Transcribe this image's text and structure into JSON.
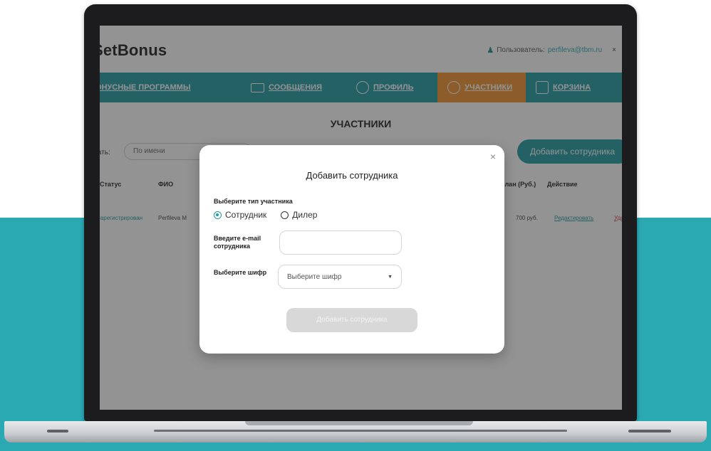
{
  "app": {
    "brand": "SetBonus",
    "user_label": "Пользователь:",
    "user_email": "perfileva@tbm.ru",
    "logout_glyph": "×"
  },
  "nav": [
    {
      "label": "БОНУСНЫЕ ПРОГРАММЫ",
      "icon": "none",
      "active": false
    },
    {
      "label": "СООБЩЕНИЯ",
      "icon": "envelope-icon",
      "active": false
    },
    {
      "label": "ПРОФИЛЬ",
      "icon": "profile-icon",
      "active": false
    },
    {
      "label": "УЧАСТНИКИ",
      "icon": "participants-icon",
      "active": true
    },
    {
      "label": "КОРЗИНА",
      "icon": "basket-icon",
      "active": false
    }
  ],
  "page": {
    "title": "УЧАСТНИКИ",
    "filter_label": "Искать:",
    "filter_value": "По имени",
    "add_button": "Добавить сотрудника",
    "table": {
      "headers": [
        "Статус",
        "ФИО",
        "План (Руб.)",
        "Действие"
      ],
      "rows": [
        {
          "status": "Зарегистрирован",
          "name": "Perfileva M",
          "plan": "700 руб.",
          "edit": "Редактировать",
          "delete": "Удалить"
        }
      ]
    }
  },
  "modal": {
    "close": "×",
    "title": "Добавить сотрудника",
    "type_label": "Выберите тип участника",
    "radio_employee": "Сотрудник",
    "radio_dealer": "Дилер",
    "email_label": "Введите e-mail сотрудника",
    "email_value": "",
    "cipher_label": "Выберите шифр",
    "cipher_placeholder": "Выберите шифр",
    "submit": "Добавить сотрудника"
  },
  "colors": {
    "teal": "#1f9aa3",
    "orange": "#f0922e",
    "background_band": "#2aa9b3"
  }
}
